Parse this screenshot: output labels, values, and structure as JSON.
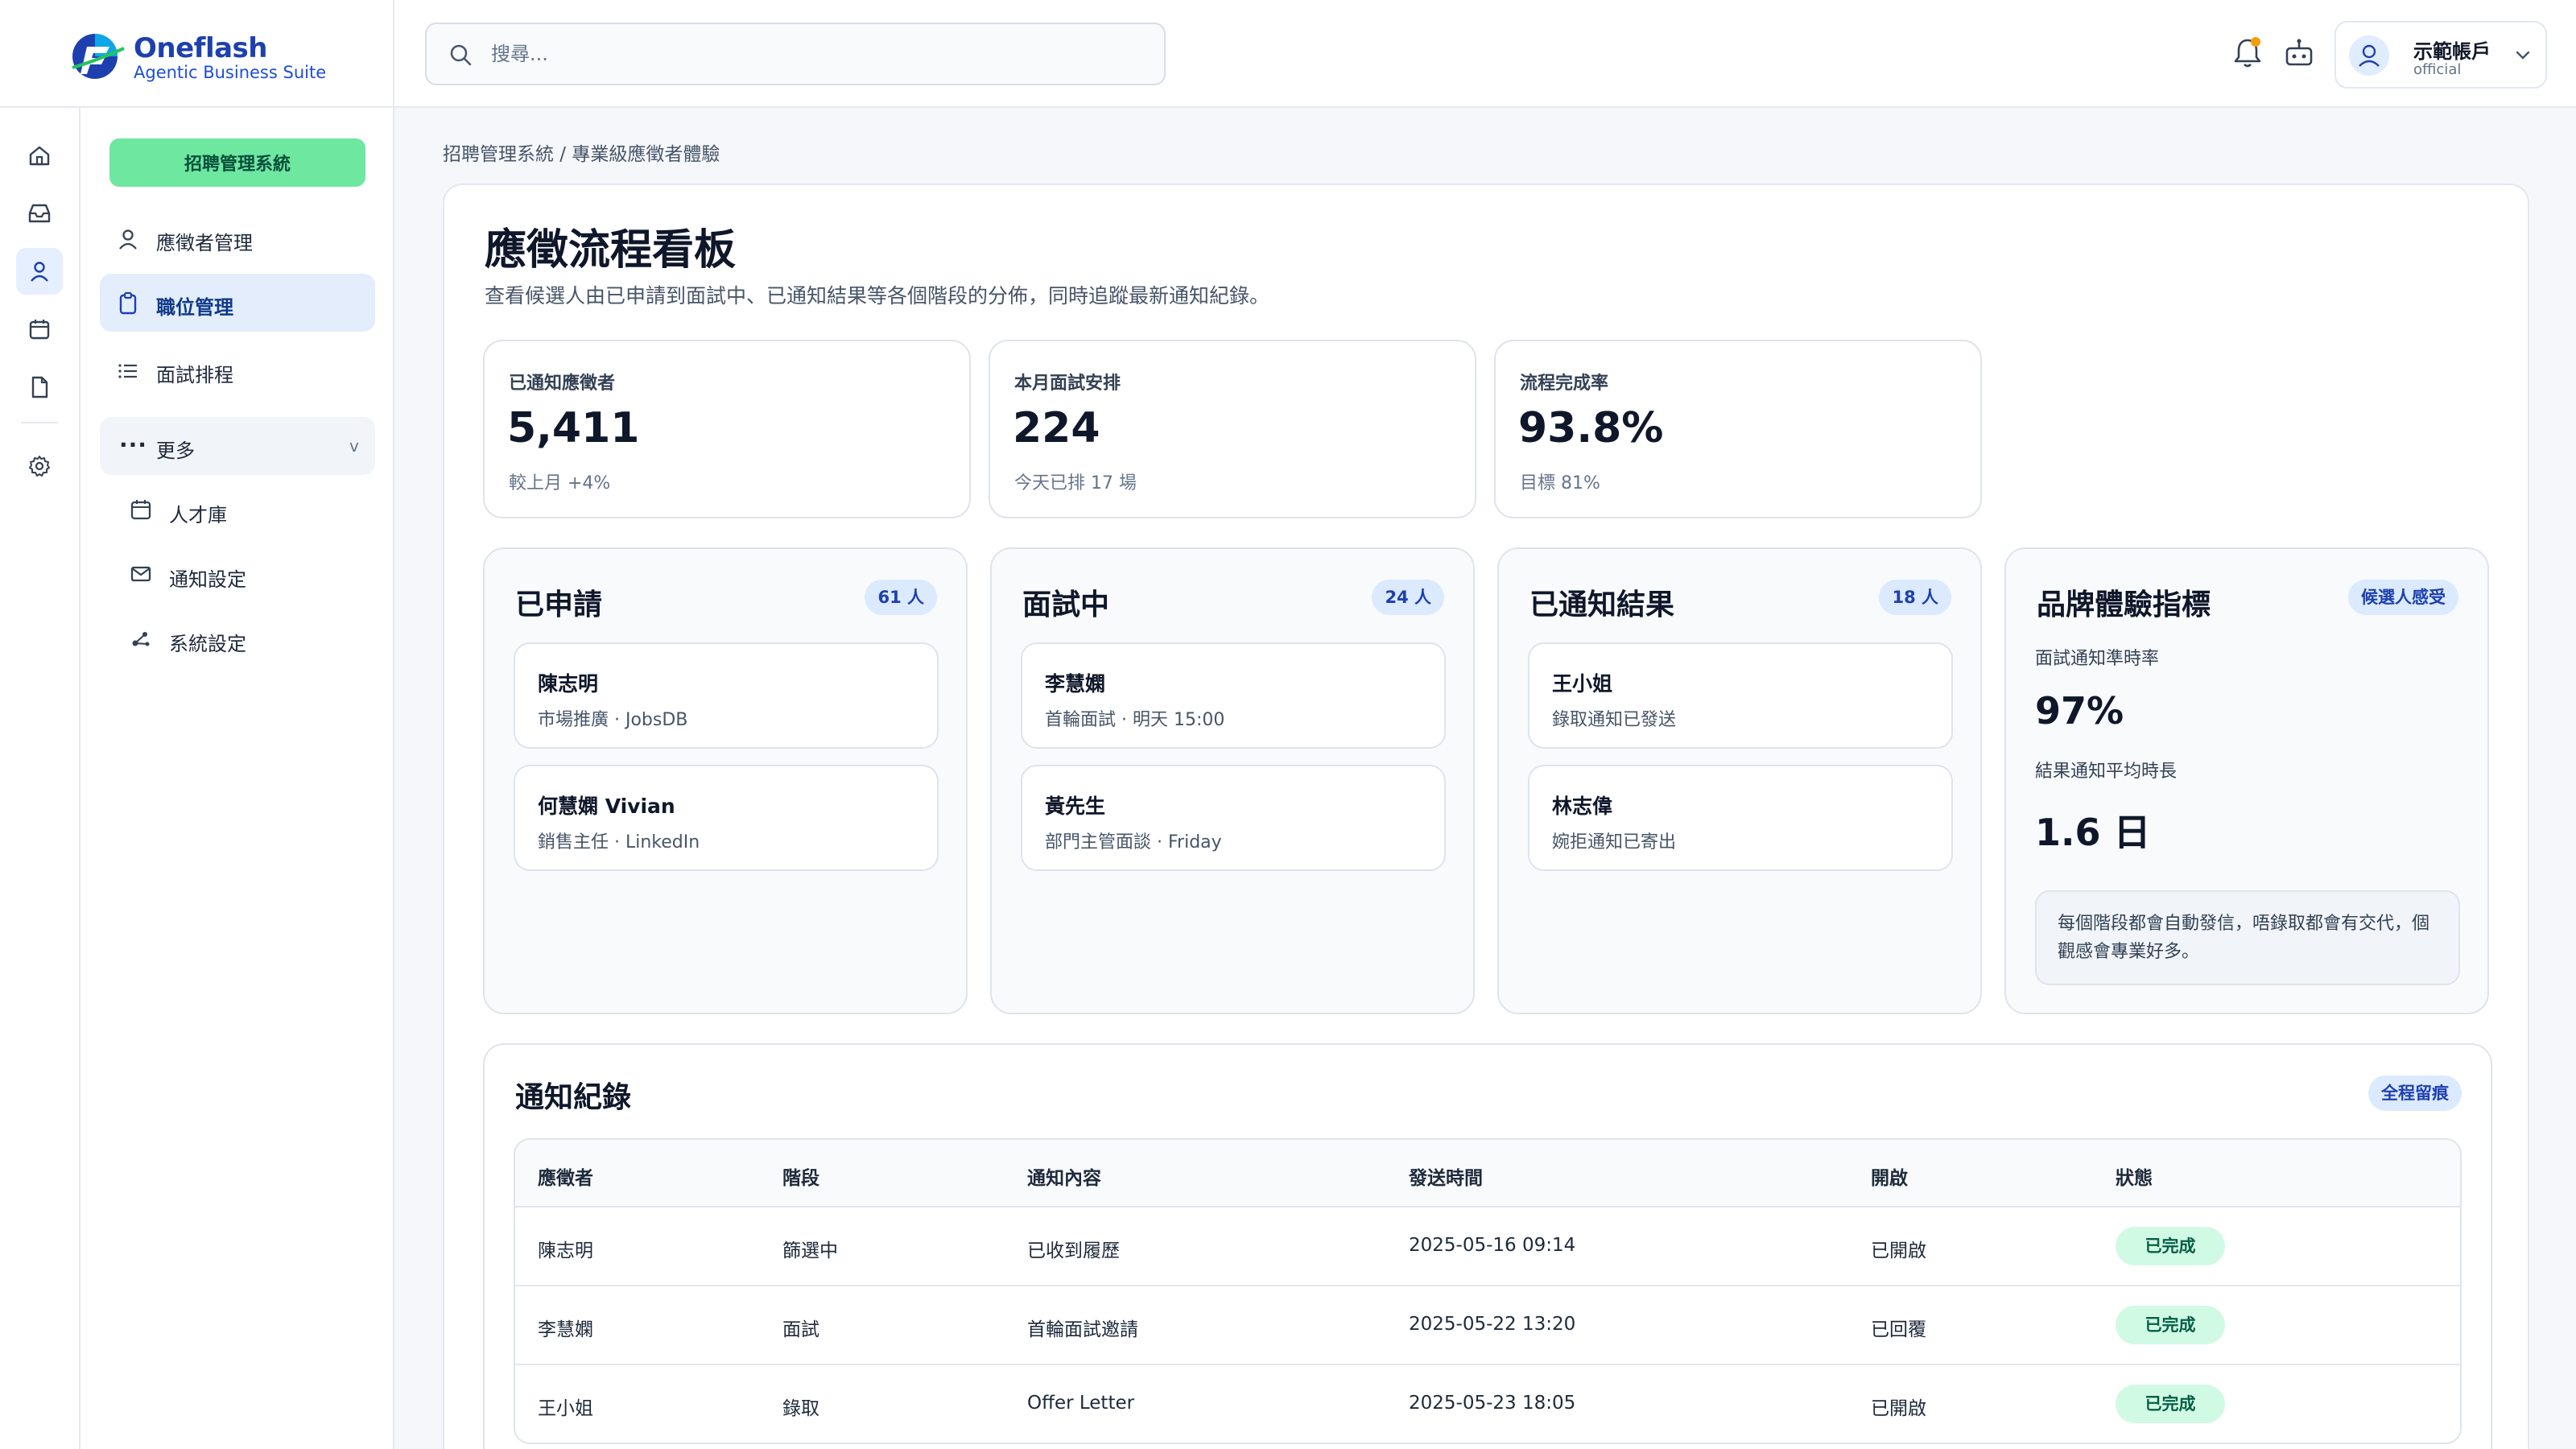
{
  "brand": {
    "name": "Oneflash",
    "subtitle": "Agentic Business Suite"
  },
  "search": {
    "placeholder": "搜尋..."
  },
  "account": {
    "name": "示範帳戶",
    "role": "official"
  },
  "sidebar": {
    "system_button": "招聘管理系統",
    "items": [
      {
        "label": "應徵者管理",
        "icon": "person-icon"
      },
      {
        "label": "職位管理",
        "icon": "clipboard-icon",
        "active": true
      },
      {
        "label": "面試排程",
        "icon": "list-icon"
      }
    ],
    "more": {
      "label": "更多",
      "chevron": "v"
    },
    "sub_items": [
      {
        "label": "人才庫",
        "icon": "calendar-icon"
      },
      {
        "label": "通知設定",
        "icon": "mail-icon"
      },
      {
        "label": "系統設定",
        "icon": "nodes-icon"
      }
    ]
  },
  "breadcrumb": "招聘管理系統 / 專業級應徵者體驗",
  "page": {
    "title": "應徵流程看板",
    "description": "查看候選人由已申請到面試中、已通知結果等各個階段的分佈，同時追蹤最新通知紀錄。"
  },
  "stats": [
    {
      "label": "已通知應徵者",
      "value": "5,411",
      "sub": "較上月 +4%"
    },
    {
      "label": "本月面試安排",
      "value": "224",
      "sub": "今天已排 17 場"
    },
    {
      "label": "流程完成率",
      "value": "93.8%",
      "sub": "目標 81%"
    }
  ],
  "columns": [
    {
      "title": "已申請",
      "count": "61 人",
      "cards": [
        {
          "name": "陳志明",
          "meta": "市場推廣 · JobsDB"
        },
        {
          "name": "何慧嫻 Vivian",
          "meta": "銷售主任 · LinkedIn"
        }
      ]
    },
    {
      "title": "面試中",
      "count": "24 人",
      "cards": [
        {
          "name": "李慧嫻",
          "meta": "首輪面試 · 明天 15:00"
        },
        {
          "name": "黃先生",
          "meta": "部門主管面談 · Friday"
        }
      ]
    },
    {
      "title": "已通知結果",
      "count": "18 人",
      "cards": [
        {
          "name": "王小姐",
          "meta": "錄取通知已發送"
        },
        {
          "name": "林志偉",
          "meta": "婉拒通知已寄出"
        }
      ]
    }
  ],
  "brand_metrics": {
    "title": "品牌體驗指標",
    "badge": "候選人感受",
    "label1": "面試通知準時率",
    "value1": "97%",
    "label2": "結果通知平均時長",
    "value2": "1.6 日",
    "note": "每個階段都會自動發信，唔錄取都會有交代，個觀感會專業好多。"
  },
  "log": {
    "title": "通知紀錄",
    "badge": "全程留痕",
    "headers": [
      "應徵者",
      "階段",
      "通知內容",
      "發送時間",
      "開啟",
      "狀態"
    ],
    "rows": [
      [
        "陳志明",
        "篩選中",
        "已收到履歷",
        "2025-05-16 09:14",
        "已開啟",
        "已完成"
      ],
      [
        "李慧嫻",
        "面試",
        "首輪面試邀請",
        "2025-05-22 13:20",
        "已回覆",
        "已完成"
      ],
      [
        "王小姐",
        "錄取",
        "Offer Letter",
        "2025-05-23 18:05",
        "已開啟",
        "已完成"
      ]
    ]
  },
  "colors": {
    "primary": "#1e40af",
    "accent_green": "#6ee7a0",
    "active_bg": "#e3edfb",
    "badge_bg": "#dbeafe",
    "status_bg": "#d1fae5"
  }
}
